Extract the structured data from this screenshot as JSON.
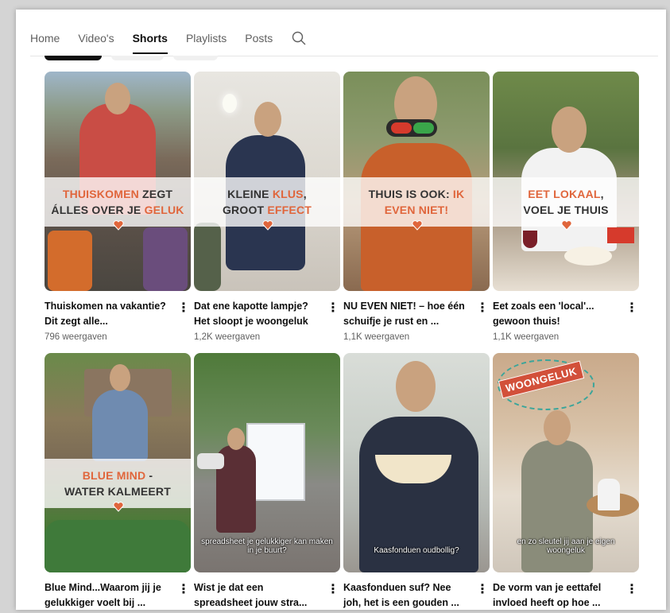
{
  "tabs": [
    {
      "label": "Home",
      "active": false
    },
    {
      "label": "Video's",
      "active": false
    },
    {
      "label": "Shorts",
      "active": true
    },
    {
      "label": "Playlists",
      "active": false
    },
    {
      "label": "Posts",
      "active": false
    }
  ],
  "search_icon": "search-icon",
  "colors": {
    "accent": "#e0663c",
    "text": "#0f0f0f",
    "secondary": "#606060"
  },
  "shorts": [
    {
      "title": "Thuiskomen na vakantie? Dit zegt alle...",
      "views": "796 weergaven",
      "overlay": [
        "THUISKOMEN",
        "ZEGT",
        "ÁLLES OVER JE",
        "GELUK"
      ]
    },
    {
      "title": "Dat ene kapotte lampje? Het sloopt je woongeluk",
      "views": "1,2K weergaven",
      "overlay": [
        "KLEINE",
        "KLUS",
        ",",
        "GROOT",
        "EFFECT"
      ]
    },
    {
      "title": "NU EVEN NIET! – hoe één schuifje je rust en ...",
      "views": "1,1K weergaven",
      "overlay": [
        "THUIS IS OOK:",
        "IK",
        "EVEN NIET!"
      ]
    },
    {
      "title": "Eet zoals een 'local'... gewoon thuis!",
      "views": "1,1K weergaven",
      "overlay": [
        "EET LOKAAL",
        ",",
        "VOEL JE THUIS"
      ]
    },
    {
      "title": "Blue Mind...Waarom jij je gelukkiger voelt bij ...",
      "views": "",
      "overlay": [
        "BLUE MIND",
        " -",
        "WATER KALMEERT"
      ]
    },
    {
      "title": "Wist je dat een spreadsheet jouw stra...",
      "views": "",
      "caption": "spreadsheet je gelukkiger kan maken in je buurt?"
    },
    {
      "title": "Kaasfonduen suf? Nee joh, het is een gouden ...",
      "views": "",
      "caption": "Kaasfonduen oudbollig?"
    },
    {
      "title": "De vorm van je eettafel invloed heeft op hoe ...",
      "views": "",
      "caption": "en zo sleutel jij aan je eigen woongeluk",
      "stamp": "WOONGELUK"
    }
  ]
}
